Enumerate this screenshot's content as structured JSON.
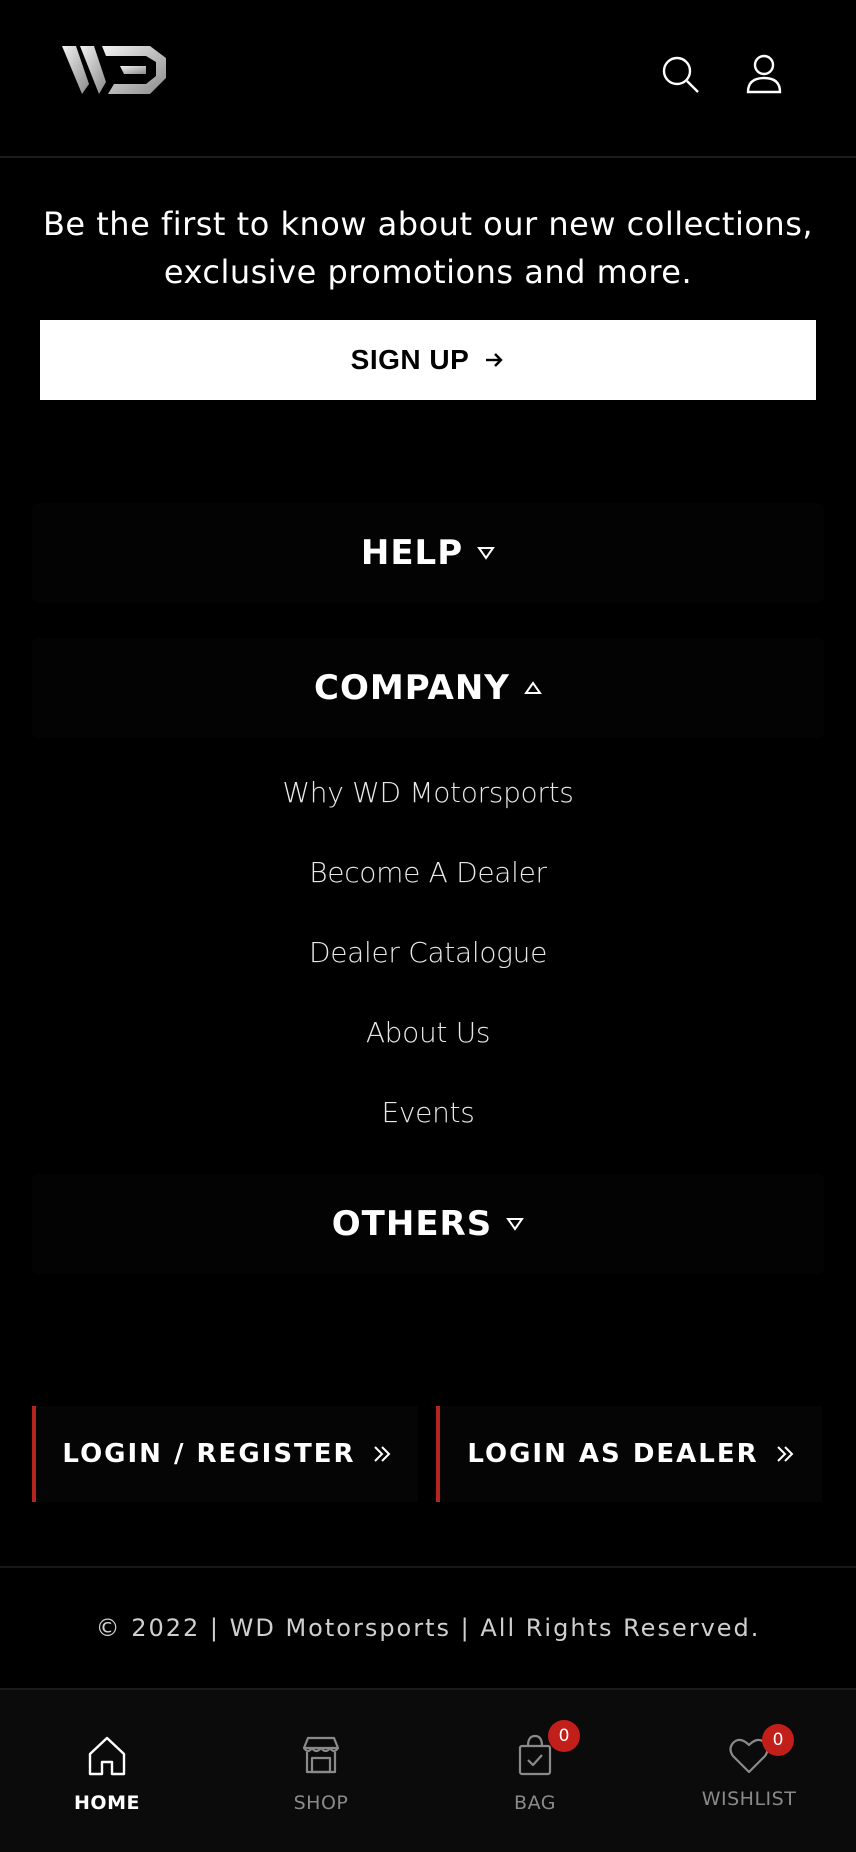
{
  "brand": {
    "logo_text": "WD"
  },
  "header": {
    "icons": [
      "search-icon",
      "user-icon"
    ]
  },
  "newsletter": {
    "line1": "Be the first to know about our new collections,",
    "line2": "exclusive promotions and more.",
    "signup_label": "SIGN UP"
  },
  "sections": {
    "help": {
      "title": "HELP",
      "expanded": false
    },
    "company": {
      "title": "COMPANY",
      "expanded": true,
      "links": [
        "Why WD Motorsports",
        "Become A Dealer",
        "Dealer Catalogue",
        "About Us",
        "Events"
      ]
    },
    "others": {
      "title": "OTHERS",
      "expanded": false
    }
  },
  "auth": {
    "login_register": "LOGIN / REGISTER",
    "login_dealer": "LOGIN AS DEALER",
    "accent_color": "#b3261e"
  },
  "footer": {
    "copyright": "© 2022 | WD Motorsports | All Rights Reserved."
  },
  "bottom_nav": {
    "home": "HOME",
    "shop": "SHOP",
    "bag": "BAG",
    "wishlist": "WISHLIST",
    "bag_count": "0",
    "wishlist_count": "0",
    "active": "home",
    "badge_color": "#c21e1a"
  }
}
